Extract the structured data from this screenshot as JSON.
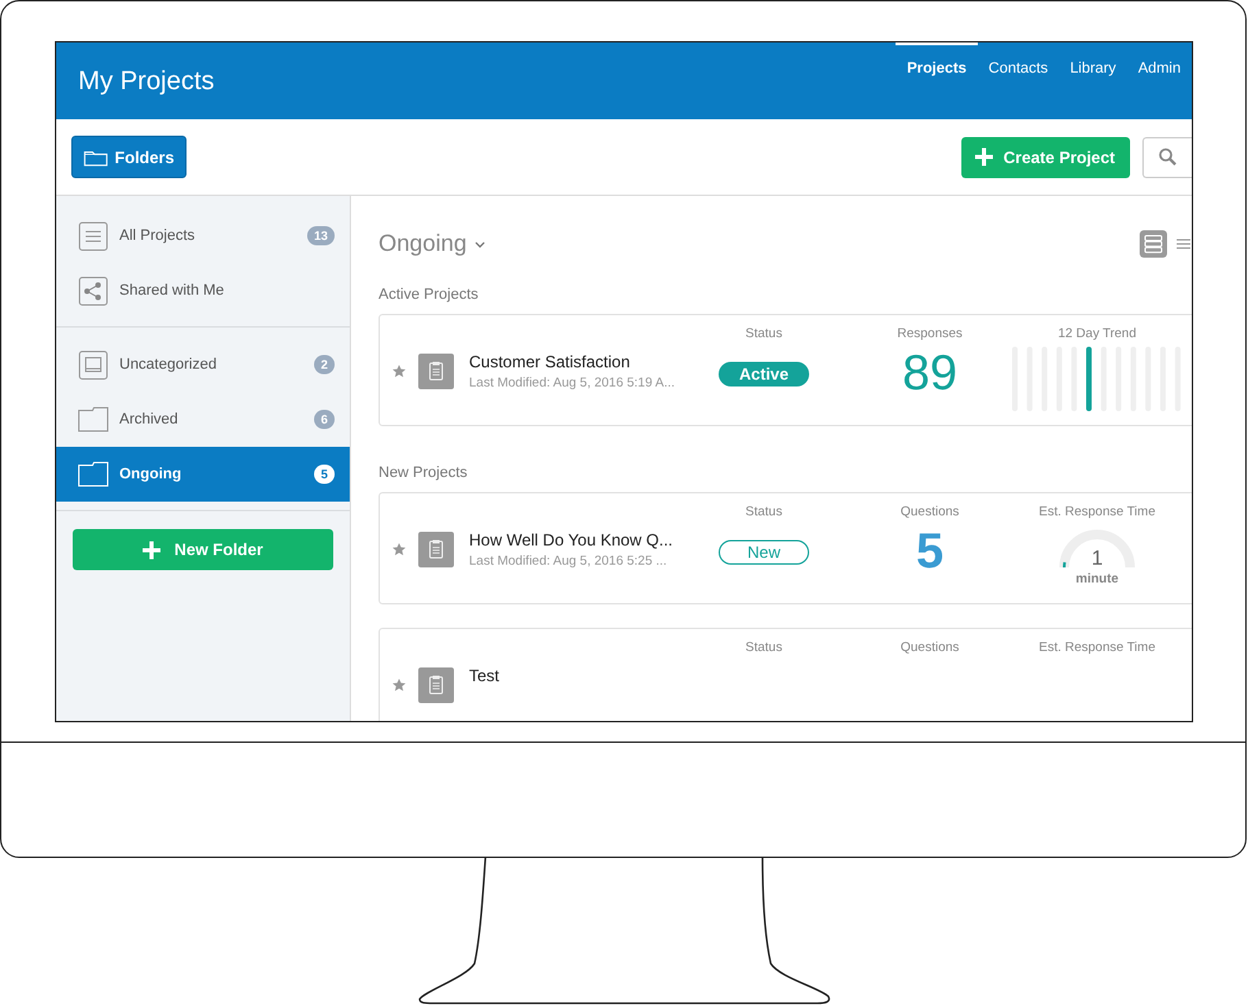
{
  "header": {
    "title": "My Projects",
    "nav": [
      {
        "label": "Projects",
        "selected": true
      },
      {
        "label": "Contacts",
        "selected": false
      },
      {
        "label": "Library",
        "selected": false
      },
      {
        "label": "Admin",
        "selected": false
      }
    ]
  },
  "toolbar": {
    "folders_button": "Folders",
    "create_button": "Create Project"
  },
  "sidebar": {
    "groups": [
      {
        "items": [
          {
            "label": "All Projects",
            "kind": "list",
            "count": "13",
            "selected": false
          },
          {
            "label": "Shared with Me",
            "kind": "shared",
            "selected": false
          }
        ]
      },
      {
        "items": [
          {
            "label": "Uncategorized",
            "kind": "inbox",
            "count": "2",
            "selected": false
          },
          {
            "label": "Archived",
            "kind": "folder",
            "count": "6",
            "selected": false
          },
          {
            "label": "Ongoing",
            "kind": "folder",
            "count": "5",
            "selected": true
          }
        ]
      }
    ],
    "new_folder_button": "New Folder"
  },
  "main": {
    "title": "Ongoing",
    "views": [
      {
        "kind": "cards",
        "selected": true
      },
      {
        "kind": "list",
        "selected": false
      }
    ],
    "sections": [
      {
        "heading": "Active Projects",
        "projects": [
          {
            "title": "Customer Satisfaction",
            "modified": "Last Modified: Aug 5, 2016 5:19 A...",
            "status_label": "Status",
            "status": {
              "label": "Active",
              "kind": "active"
            },
            "metric": {
              "label": "Responses",
              "value": "89",
              "kind": "responses"
            },
            "extra": {
              "label": "12 Day Trend",
              "kind": "trend"
            }
          }
        ]
      },
      {
        "heading": "New Projects",
        "projects": [
          {
            "title": "How Well Do You Know Q...",
            "modified": "Last Modified: Aug 5, 2016 5:25 ...",
            "status_label": "Status",
            "status": {
              "label": "New",
              "kind": "new"
            },
            "metric": {
              "label": "Questions",
              "value": "5",
              "kind": "questions"
            },
            "extra": {
              "label": "Est. Response Time",
              "kind": "gauge",
              "value": "1",
              "unit": "minute",
              "level": 0.05
            }
          },
          {
            "title": "Test",
            "status_label": "Status",
            "metric": {
              "label": "Questions"
            },
            "extra": {
              "label": "Est. Response Time",
              "kind": "gauge"
            }
          }
        ]
      }
    ]
  }
}
